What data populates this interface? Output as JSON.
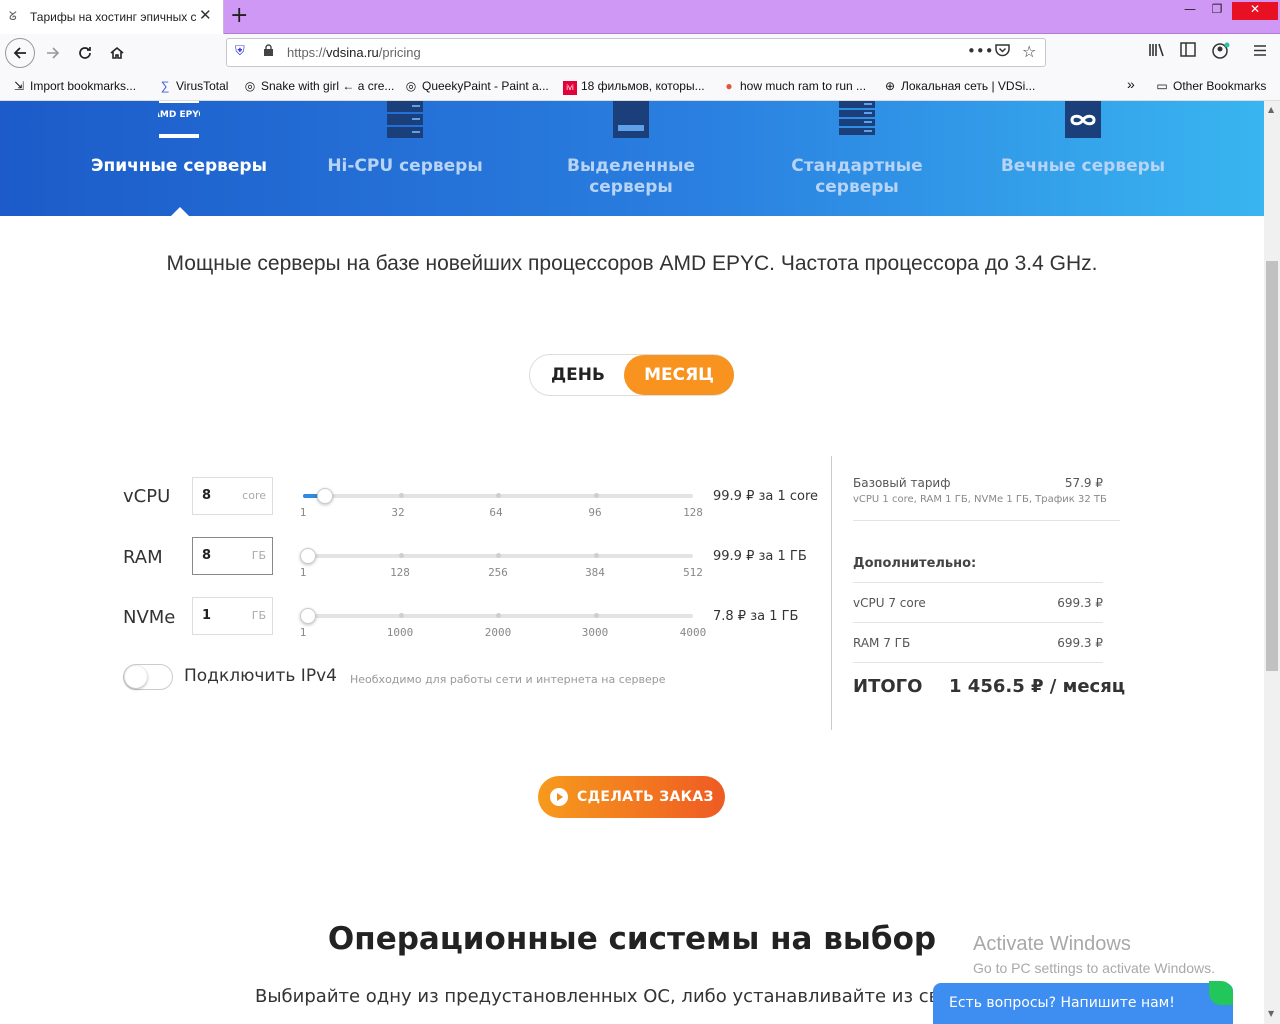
{
  "browser": {
    "tab_title": "Тарифы на хостинг эпичных с",
    "tab_close": "✕",
    "new_tab": "+",
    "url_prefix": "https://",
    "url_domain": "vdsina.ru",
    "url_path": "/pricing",
    "window": {
      "min": "—",
      "max": "❐",
      "close": "✕"
    }
  },
  "bookmarks": [
    {
      "label": "Import bookmarks...",
      "icon": "import-icon"
    },
    {
      "label": "VirusTotal",
      "icon": "virustotal-icon"
    },
    {
      "label": "Snake with girl ← a cre...",
      "icon": "snake-icon"
    },
    {
      "label": "QueekyPaint - Paint a...",
      "icon": "queekypaint-icon"
    },
    {
      "label": "18 фильмов, которы...",
      "icon": "ivi-icon"
    },
    {
      "label": "how much ram to run ...",
      "icon": "duckduckgo-icon"
    },
    {
      "label": "Локальная сеть | VDSi...",
      "icon": "globe-icon"
    },
    {
      "label": "Other Bookmarks",
      "icon": "folder-icon"
    }
  ],
  "hero": {
    "categories": [
      {
        "label": "Эпичные серверы",
        "icon": "amd-epyc-icon",
        "icon_text": "AMD EPYC",
        "active": true
      },
      {
        "label": "Hi-CPU серверы",
        "icon": "server-rack-icon",
        "active": false
      },
      {
        "label": "Выделенные серверы",
        "icon": "dedicated-server-icon",
        "active": false
      },
      {
        "label": "Стандартные серверы",
        "icon": "standard-server-icon",
        "active": false
      },
      {
        "label": "Вечные серверы",
        "icon": "infinity-server-icon",
        "active": false
      }
    ]
  },
  "description": "Мощные серверы на базе новейших процессоров AMD EPYC. Частота процессора до 3.4 GHz.",
  "period": {
    "day": "ДЕНЬ",
    "month": "МЕСЯЦ",
    "selected": "month"
  },
  "resources": [
    {
      "label": "vCPU",
      "value": "8",
      "unit": "core",
      "min": 1,
      "max": 128,
      "current": 8,
      "ticks": [
        "1",
        "32",
        "64",
        "96",
        "128"
      ],
      "price": "99.9 ₽ за 1 core"
    },
    {
      "label": "RAM",
      "value": "8",
      "unit": "ГБ",
      "min": 1,
      "max": 512,
      "current": 8,
      "ticks": [
        "1",
        "128",
        "256",
        "384",
        "512"
      ],
      "price": "99.9 ₽ за 1 ГБ"
    },
    {
      "label": "NVMe",
      "value": "1",
      "unit": "ГБ",
      "min": 1,
      "max": 4000,
      "current": 1,
      "ticks": [
        "1",
        "1000",
        "2000",
        "3000",
        "4000"
      ],
      "price": "7.8 ₽ за 1 ГБ"
    }
  ],
  "ipv4": {
    "label": "Подключить IPv4",
    "hint": "Необходимо для работы сети и интернета на сервере",
    "enabled": false
  },
  "summary": {
    "base_label": "Базовый тариф",
    "base_price": "57.9 ₽",
    "base_details": "vCPU 1 core, RAM 1 ГБ, NVMe 1 ГБ, Трафик 32 ТБ",
    "extra_title": "Дополнительно:",
    "extras": [
      {
        "label": "vCPU 7 core",
        "price": "699.3 ₽"
      },
      {
        "label": "RAM 7 ГБ",
        "price": "699.3 ₽"
      }
    ],
    "total_label": "ИТОГО",
    "total_value": "1 456.5 ₽ / месяц"
  },
  "order_button": "СДЕЛАТЬ ЗАКАЗ",
  "os_section": {
    "title": "Операционные системы на выбор",
    "subtitle": "Выбирайте одну из предустановленных ОС, либо устанавливайте из своего"
  },
  "activate_windows": {
    "title": "Activate Windows",
    "subtitle": "Go to PC settings to activate Windows."
  },
  "chat": {
    "label": "Есть вопросы? Напишите нам!"
  },
  "colors": {
    "accent": "#f7931e",
    "hero_blue": "#1c5bc9",
    "slider_fill": "#2a8ae6",
    "chat": "#3d8ef0"
  }
}
